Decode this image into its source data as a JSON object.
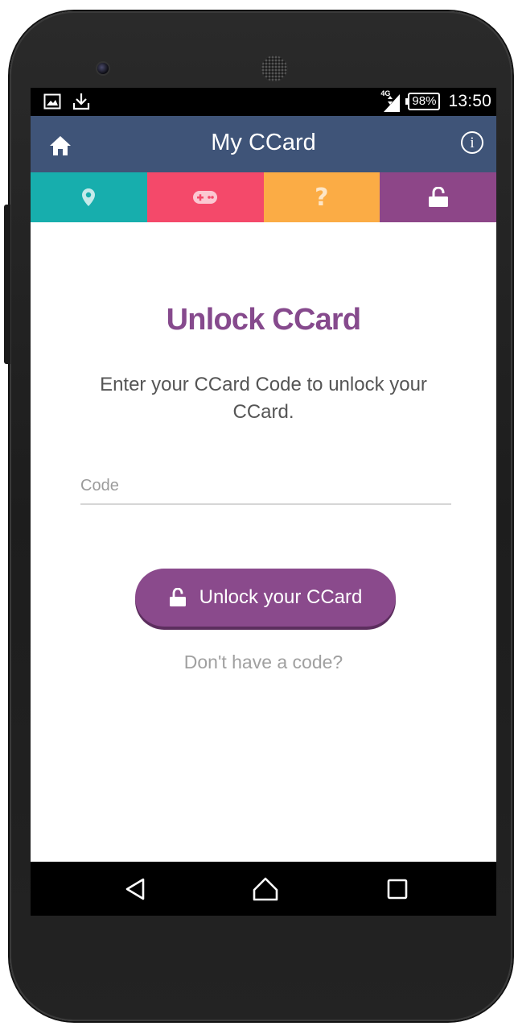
{
  "status_bar": {
    "network_type": "4G",
    "battery": "98%",
    "time": "13:50"
  },
  "toolbar": {
    "title": "My CCard"
  },
  "tabs": [
    {
      "icon": "location-pin-icon",
      "color": "#17aead"
    },
    {
      "icon": "gamepad-icon",
      "color": "#f4496a"
    },
    {
      "icon": "question-icon",
      "color": "#fbac45",
      "glyph": "?"
    },
    {
      "icon": "unlock-icon",
      "color": "#8d4688",
      "active": true
    }
  ],
  "unlock": {
    "heading": "Unlock CCard",
    "description": "Enter your CCard Code to unlock your CCard.",
    "code_placeholder": "Code",
    "code_value": "",
    "button_label": "Unlock your CCard",
    "no_code_link": "Don't have a code?"
  },
  "colors": {
    "toolbar": "#3f5478",
    "accent": "#8a4a8c",
    "heading": "#864a8d"
  }
}
